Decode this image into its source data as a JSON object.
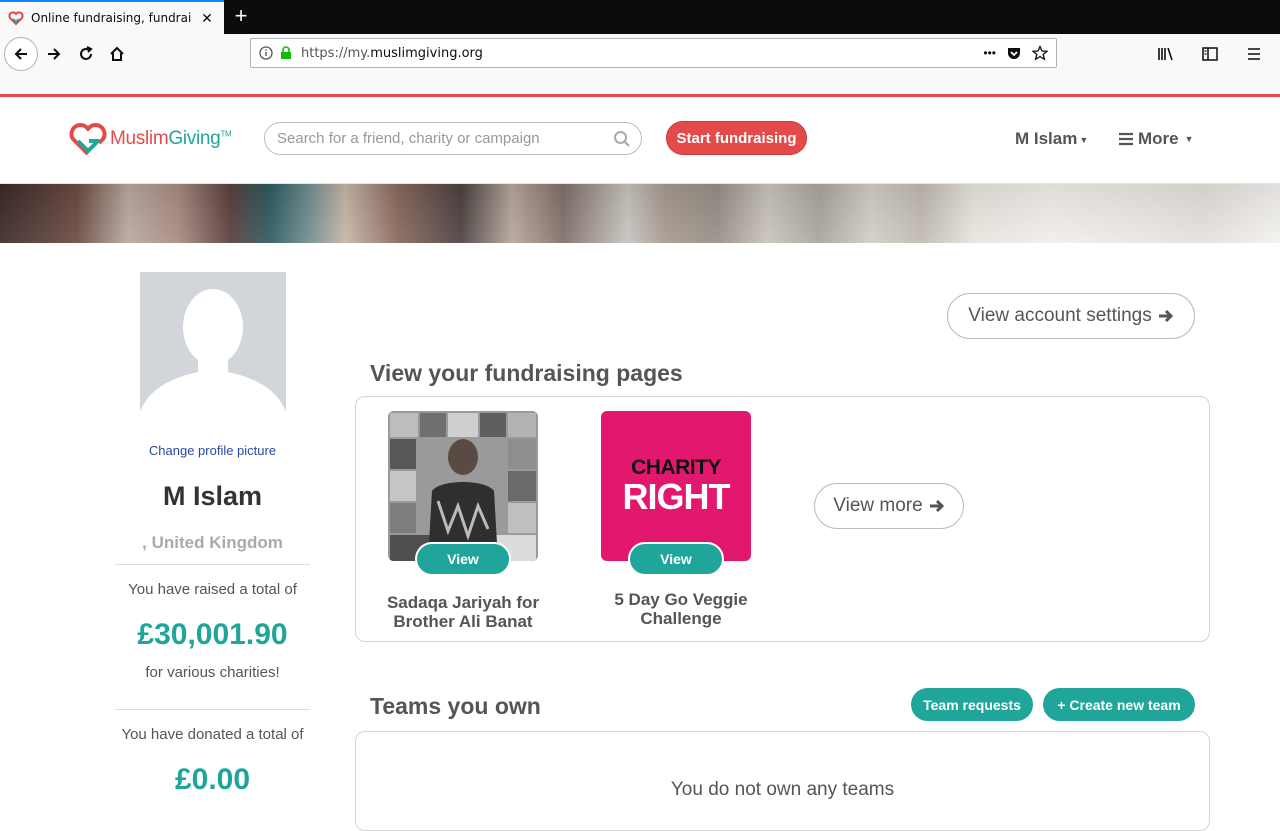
{
  "browser": {
    "tab_title": "Online fundraising, fundraising i",
    "url_prefix": "https://my.",
    "url_domain": "muslimgiving.org",
    "url_overflow": "•••"
  },
  "header": {
    "logo_muslim": "Muslim",
    "logo_giving": "Giving",
    "logo_tm": "TM",
    "search_placeholder": "Search for a friend, charity or campaign",
    "start_label": "Start fundraising",
    "user_label": "M Islam",
    "more_label": "More"
  },
  "profile": {
    "change_picture": "Change profile picture",
    "name": "M Islam",
    "location": ", United Kingdom",
    "raised_label": "You have raised a total of",
    "raised_value": "£30,001.90",
    "raised_suffix": "for various charities!",
    "donated_label": "You have donated a total of",
    "donated_value": "£0.00"
  },
  "main": {
    "account_settings": "View account settings",
    "pages_title": "View your fundraising pages",
    "pages": [
      {
        "caption": "Sadaqa Jariyah for Brother Ali Banat",
        "view_label": "View"
      },
      {
        "caption": "5 Day Go Veggie Challenge",
        "view_label": "View",
        "logo_line1": "CHARITY",
        "logo_line2": "RIGHT"
      }
    ],
    "view_more": "View more",
    "teams_title": "Teams you own",
    "team_requests": "Team requests",
    "create_team": "+ Create new team",
    "no_teams": "You do not own any teams"
  },
  "colors": {
    "brand_red": "#e54a4a",
    "brand_teal": "#1fa59a",
    "charity_right_pink": "#e2186e"
  }
}
